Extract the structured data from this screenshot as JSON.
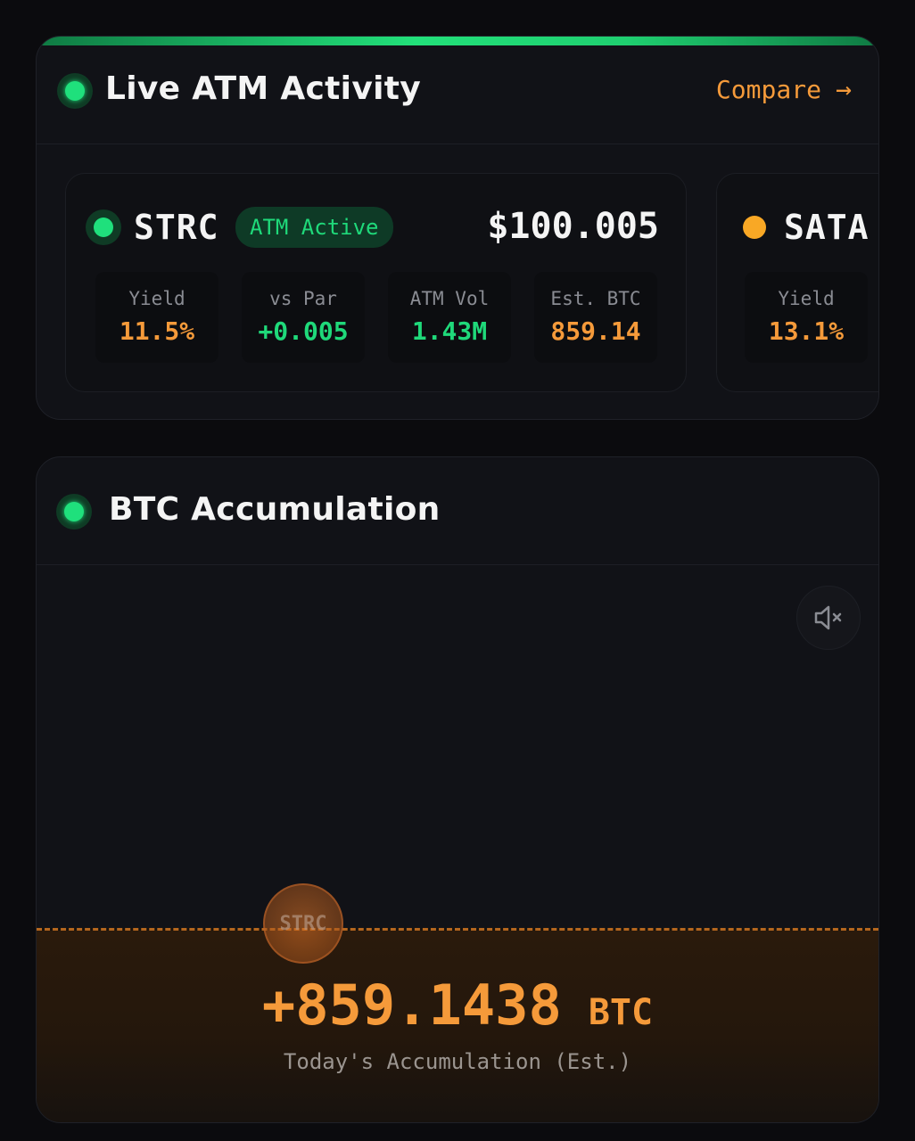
{
  "atm_panel": {
    "title": "Live ATM Activity",
    "compare_label": "Compare",
    "compare_icon": "arrow-right-icon",
    "cards": [
      {
        "ticker": "STRC",
        "badge": "ATM Active",
        "price": "$100.005",
        "stats": [
          {
            "label": "Yield",
            "value": "11.5%"
          },
          {
            "label": "vs Par",
            "value": "+0.005"
          },
          {
            "label": "ATM Vol",
            "value": "1.43M"
          },
          {
            "label": "Est. BTC",
            "value": "859.14"
          }
        ]
      },
      {
        "ticker": "SATA",
        "stats": [
          {
            "label": "Yield",
            "value": "13.1%"
          }
        ]
      }
    ]
  },
  "accumulation_panel": {
    "title": "BTC Accumulation",
    "mute_icon": "speaker-muted-icon",
    "bubble_label": "STRC",
    "value": "+859.1438",
    "unit": "BTC",
    "caption": "Today's Accumulation (Est.)"
  },
  "colors": {
    "accent_green": "#1fe07c",
    "accent_orange": "#f59a3a",
    "sata_dot": "#f9a825",
    "background": "#0b0b0e",
    "panel": "#111217"
  }
}
